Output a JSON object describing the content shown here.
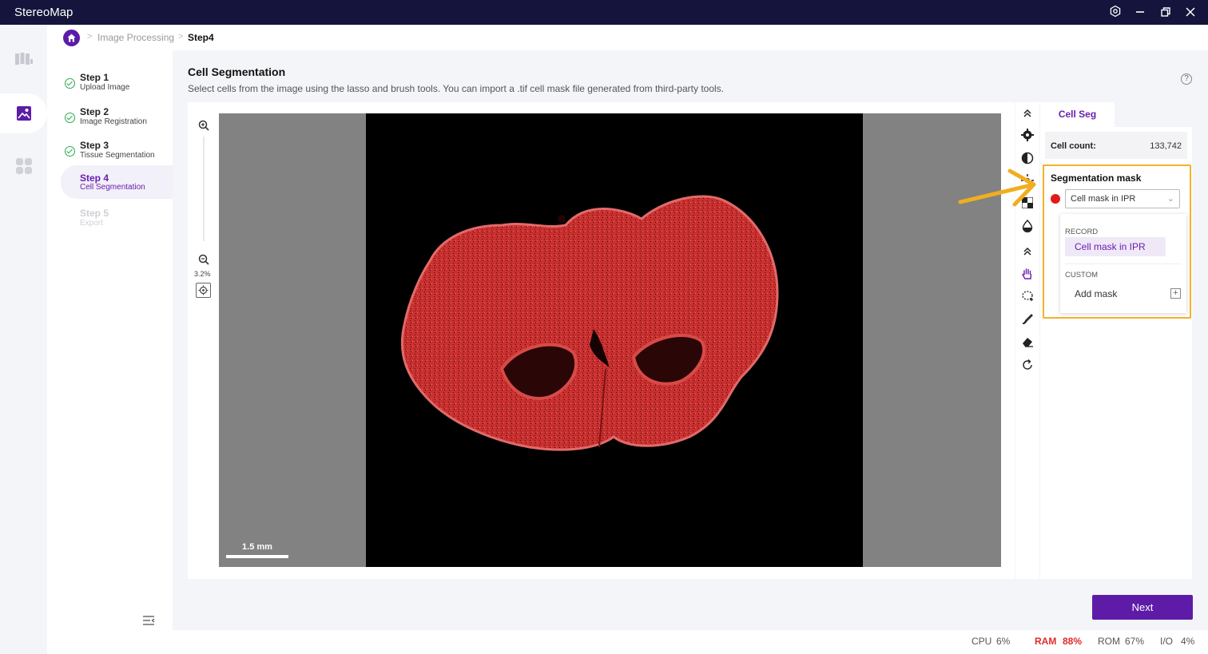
{
  "app": {
    "title": "StereoMap",
    "window_icons": [
      "settings-icon",
      "minimize-icon",
      "restore-icon",
      "close-icon"
    ]
  },
  "left_rail": {
    "items": [
      {
        "icon": "map-icon",
        "active": false
      },
      {
        "icon": "image-icon",
        "active": true
      },
      {
        "icon": "apps-grid-icon",
        "active": false
      }
    ]
  },
  "breadcrumb": {
    "items": [
      "Image Processing",
      "Step4"
    ]
  },
  "steps": [
    {
      "title": "Step 1",
      "subtitle": "Upload Image",
      "state": "done"
    },
    {
      "title": "Step 2",
      "subtitle": "Image Registration",
      "state": "done"
    },
    {
      "title": "Step 3",
      "subtitle": "Tissue Segmentation",
      "state": "done"
    },
    {
      "title": "Step 4",
      "subtitle": "Cell Segmentation",
      "state": "active"
    },
    {
      "title": "Step 5",
      "subtitle": "Export",
      "state": "disabled"
    }
  ],
  "page": {
    "title": "Cell Segmentation",
    "description": "Select cells from the image using the lasso and brush tools. You can import a .tif cell mask file generated from third-party tools."
  },
  "viewer": {
    "zoom_level": "3.2%",
    "scale_bar": "1.5 mm",
    "mask_color": "#e0353a"
  },
  "tools": [
    "collapse-up-icon",
    "settings-gear-icon",
    "contrast-icon",
    "brightness-icon",
    "checker-icon",
    "drop-icon",
    "collapse-up-icon",
    "hand-icon",
    "lasso-icon",
    "brush-icon",
    "eraser-icon",
    "reset-icon"
  ],
  "panel": {
    "tab": "Cell Seg",
    "cell_count_label": "Cell count:",
    "cell_count_value": "133,742",
    "mask_title": "Segmentation mask",
    "mask_selected": "Cell mask in IPR",
    "dropdown": {
      "record_label": "RECORD",
      "record_item": "Cell mask in IPR",
      "custom_label": "CUSTOM",
      "add_label": "Add mask"
    }
  },
  "actions": {
    "next": "Next"
  },
  "status": {
    "cpu_label": "CPU",
    "cpu_value": "6%",
    "ram_label": "RAM",
    "ram_value": "88%",
    "rom_label": "ROM",
    "rom_value": "67%",
    "io_label": "I/O",
    "io_value": "4%"
  },
  "colors": {
    "titlebar": "#14143c",
    "accent": "#5e1ba7",
    "highlight": "#f3b22a",
    "warning": "#e02b2b"
  }
}
